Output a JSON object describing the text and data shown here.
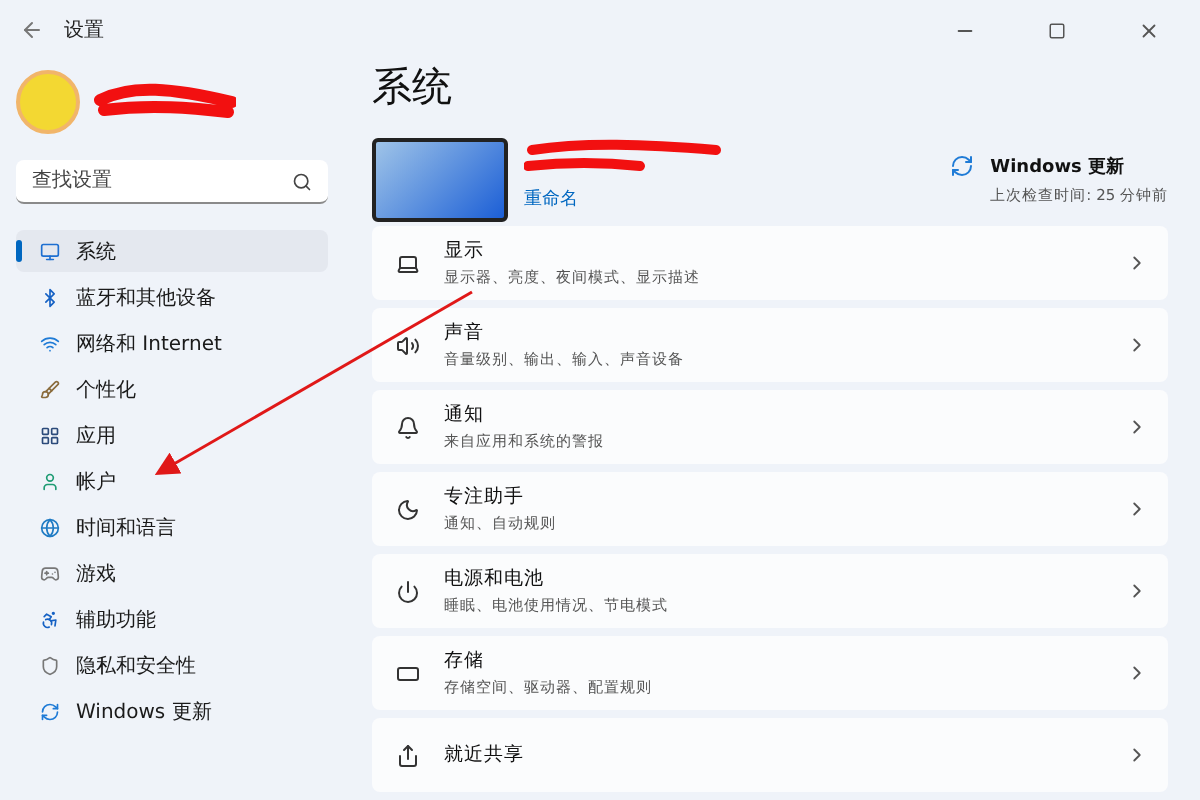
{
  "window": {
    "title": "设置"
  },
  "search": {
    "placeholder": "查找设置"
  },
  "sidebar": {
    "items": [
      {
        "label": "系统",
        "selected": true
      },
      {
        "label": "蓝牙和其他设备",
        "selected": false
      },
      {
        "label": "网络和 Internet",
        "selected": false
      },
      {
        "label": "个性化",
        "selected": false
      },
      {
        "label": "应用",
        "selected": false
      },
      {
        "label": "帐户",
        "selected": false
      },
      {
        "label": "时间和语言",
        "selected": false
      },
      {
        "label": "游戏",
        "selected": false
      },
      {
        "label": "辅助功能",
        "selected": false
      },
      {
        "label": "隐私和安全性",
        "selected": false
      },
      {
        "label": "Windows 更新",
        "selected": false
      }
    ]
  },
  "page": {
    "title": "系统",
    "device": {
      "rename_link": "重命名"
    },
    "update": {
      "title": "Windows 更新",
      "subtitle": "上次检查时间: 25 分钟前"
    }
  },
  "cards": [
    {
      "title": "显示",
      "subtitle": "显示器、亮度、夜间模式、显示描述"
    },
    {
      "title": "声音",
      "subtitle": "音量级别、输出、输入、声音设备"
    },
    {
      "title": "通知",
      "subtitle": "来自应用和系统的警报"
    },
    {
      "title": "专注助手",
      "subtitle": "通知、自动规则"
    },
    {
      "title": "电源和电池",
      "subtitle": "睡眠、电池使用情况、节电模式"
    },
    {
      "title": "存储",
      "subtitle": "存储空间、驱动器、配置规则"
    },
    {
      "title": "就近共享"
    }
  ]
}
